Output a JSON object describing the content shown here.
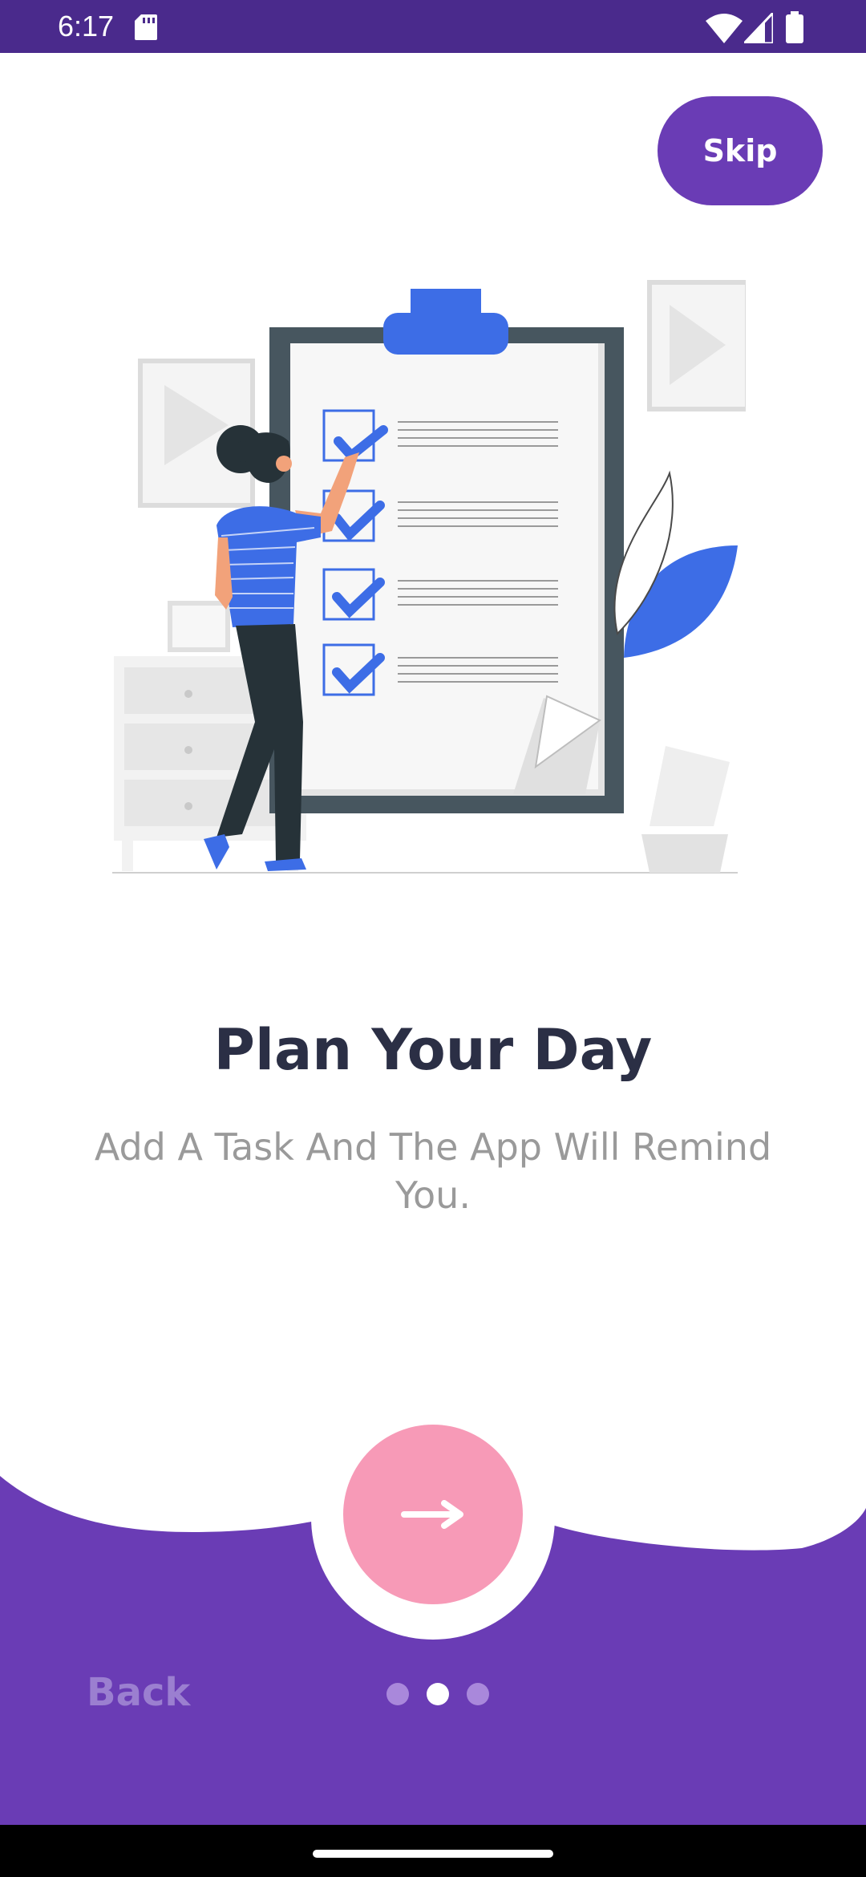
{
  "status_bar": {
    "time": "6:17",
    "icons": [
      "sd-card-icon",
      "wifi-icon",
      "signal-icon",
      "battery-icon"
    ]
  },
  "onboarding": {
    "skip_label": "Skip",
    "title": "Plan Your Day",
    "subtitle": "Add A Task And The App Will Remind You.",
    "back_label": "Back",
    "next_icon": "arrow-right-icon",
    "page_indicator": {
      "total": 3,
      "current": 2
    }
  },
  "colors": {
    "primary": "#6a3cb5",
    "status_bar": "#4a2a8c",
    "accent_pink": "#f79ab7",
    "title_text": "#2b2f45",
    "subtitle_text": "#9a9a9a",
    "illustration_blue": "#3d6de6"
  }
}
